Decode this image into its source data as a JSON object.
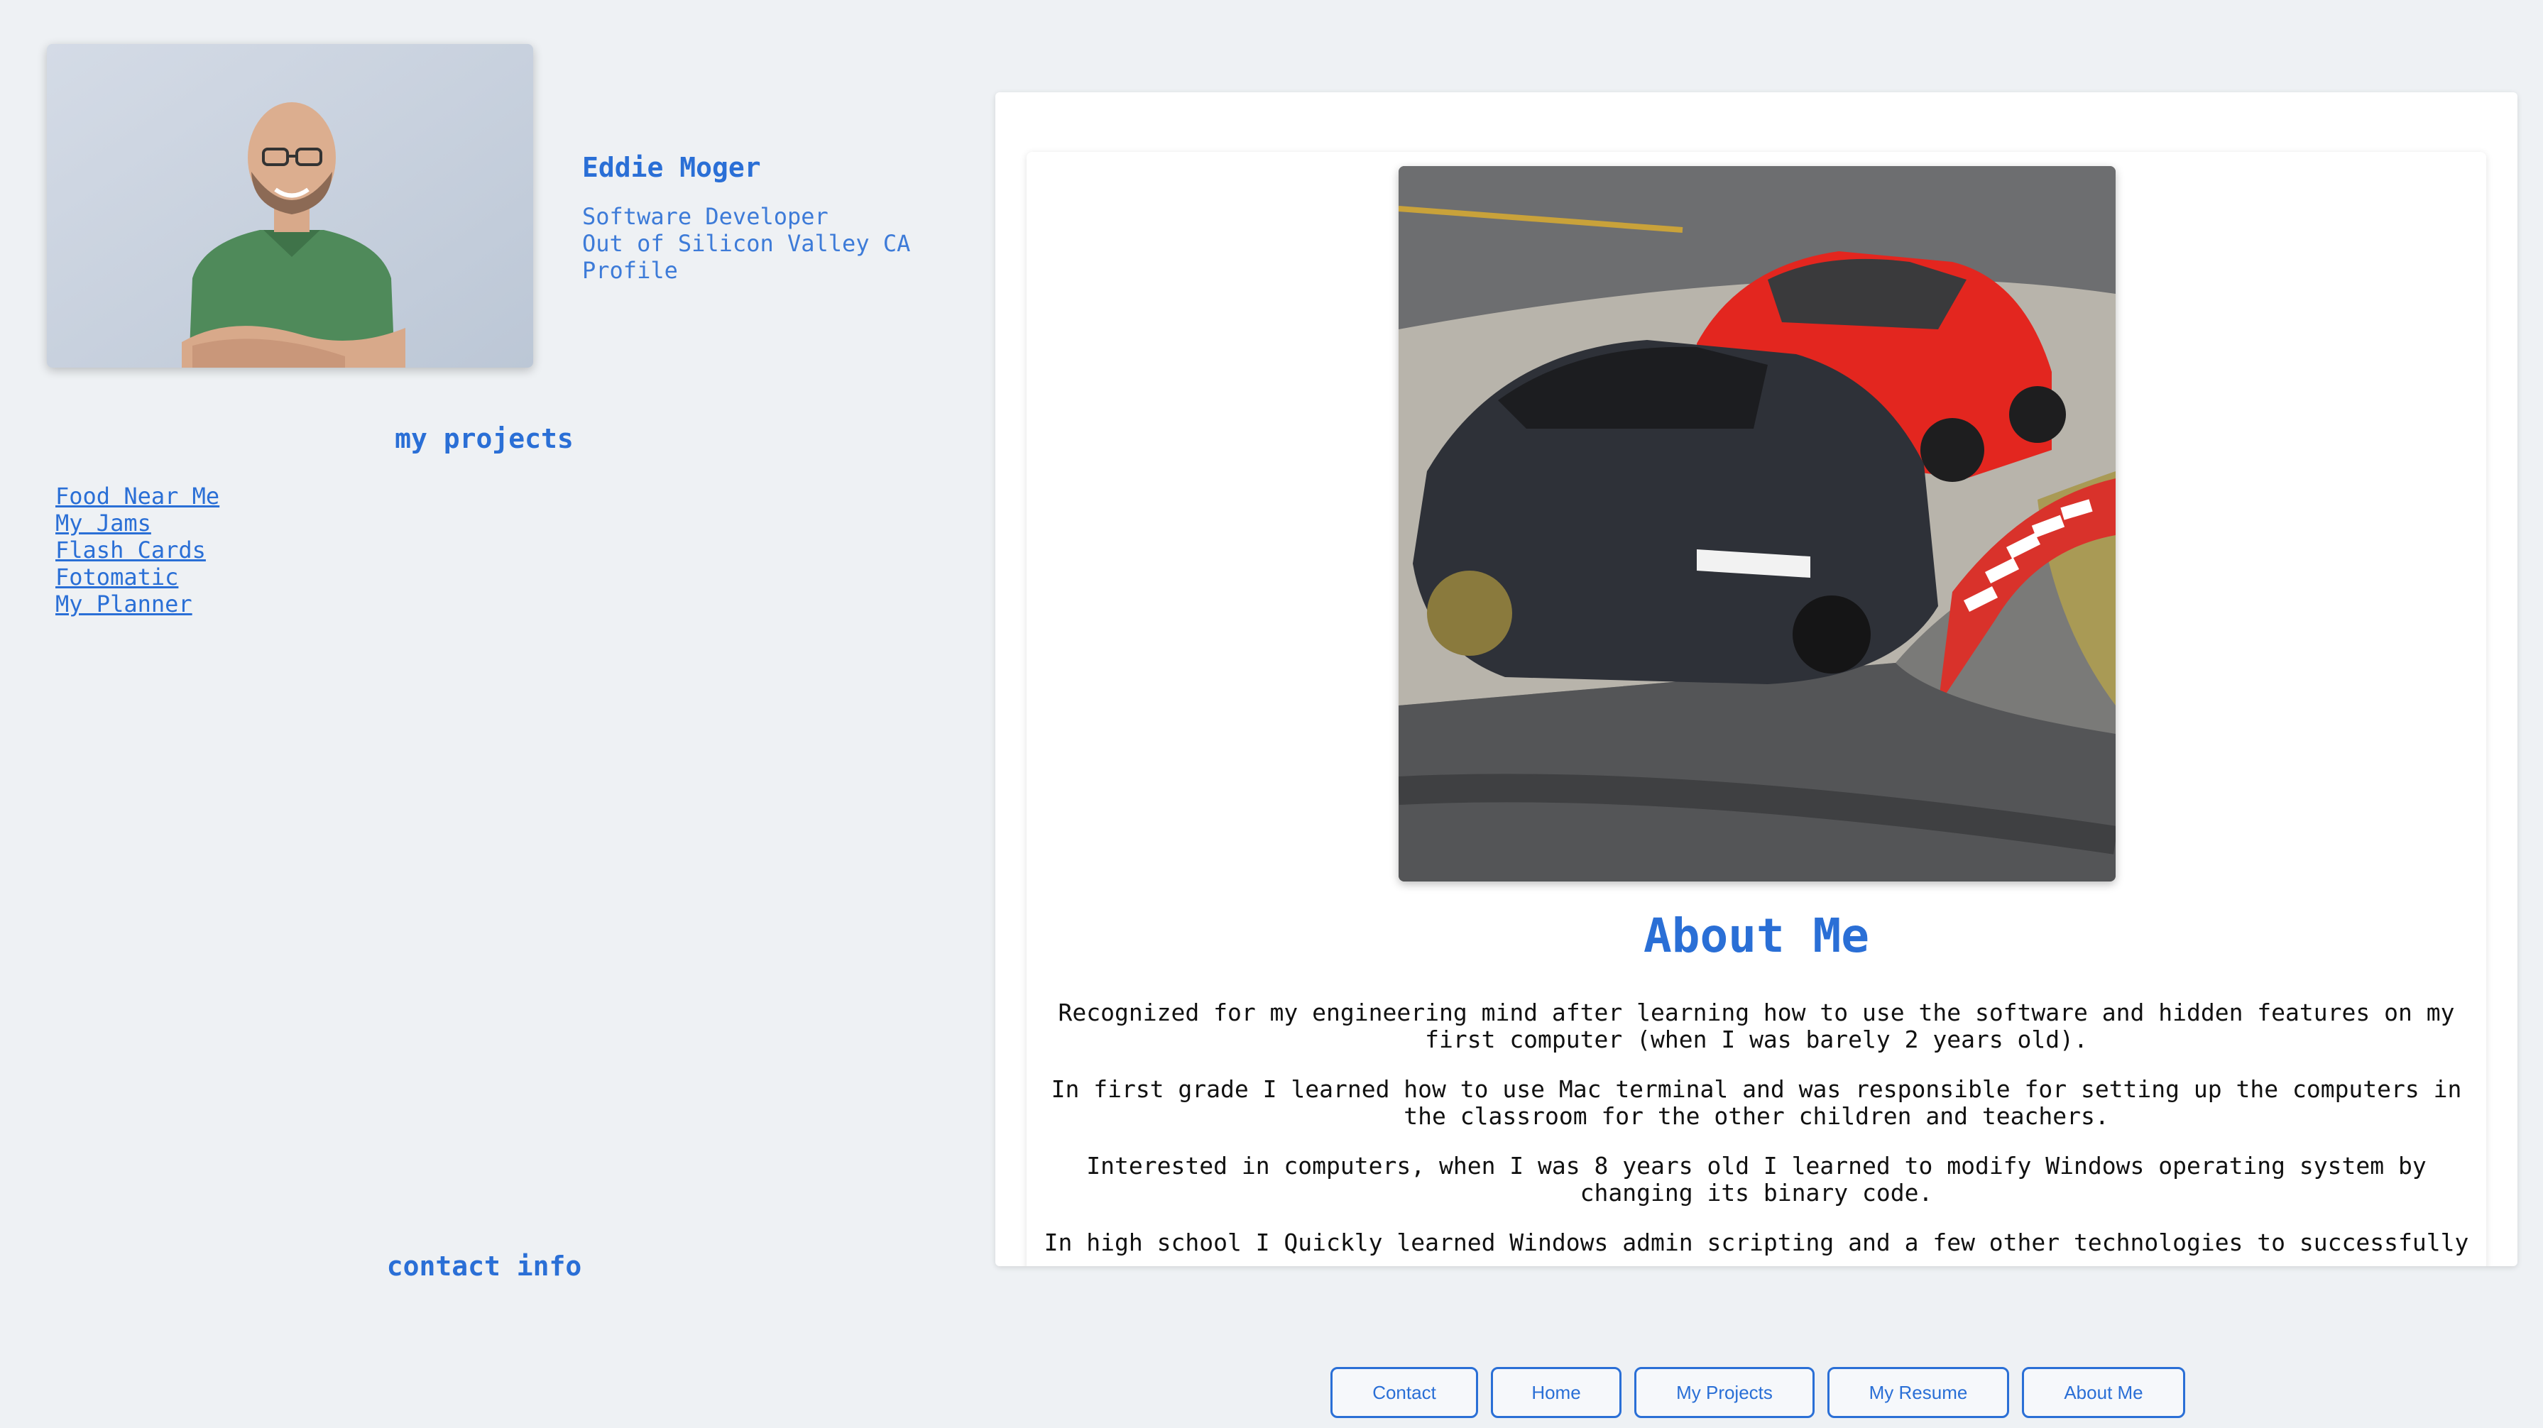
{
  "profile": {
    "name": "Eddie Moger",
    "title": "Software Developer",
    "location": "Out of Silicon Valley CA",
    "link_label": "Profile"
  },
  "projects": {
    "heading": "my projects",
    "items": [
      "Food Near Me",
      "My Jams",
      "Flash Cards",
      "Fotomatic",
      "My Planner"
    ]
  },
  "contact": {
    "heading": "contact info"
  },
  "about": {
    "title": "About Me",
    "paragraphs": [
      "Recognized for my engineering mind after learning how to use the software and hidden features on my first computer (when I was barely 2 years old).",
      "In first grade I learned how to use Mac terminal and was responsible for setting up the computers in the classroom for the other children and teachers.",
      "Interested in computers, when I was 8 years old I learned to modify Windows operating system by changing its binary code.",
      "In high school I Quickly learned Windows admin scripting and a few other technologies to successfully"
    ]
  },
  "nav": {
    "buttons": [
      "Contact",
      "Home",
      "My Projects",
      "My Resume",
      "About Me"
    ]
  },
  "colors": {
    "accent": "#2a6fd6",
    "background": "#eef1f4",
    "panel": "#ffffff",
    "body_text": "#111111"
  }
}
